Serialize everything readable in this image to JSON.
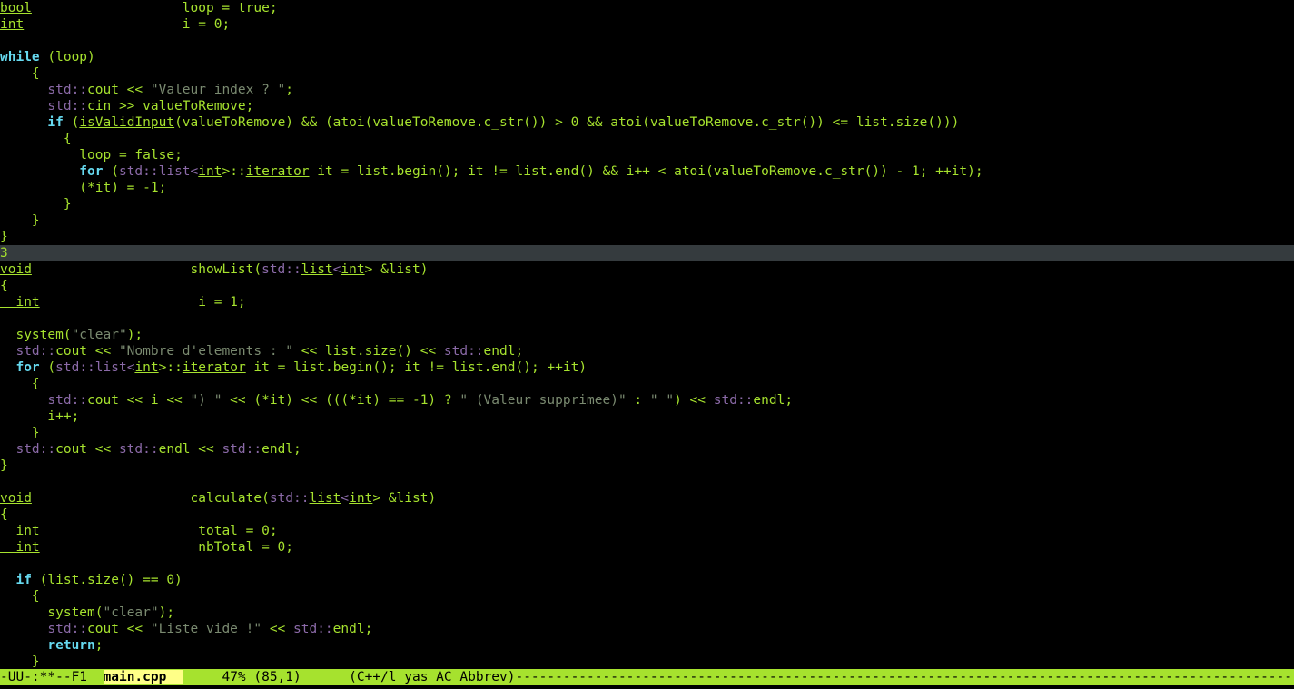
{
  "editor": {
    "lines": [
      [
        {
          "c": "type",
          "t": "bool"
        },
        {
          "c": "plain",
          "t": "                   loop = "
        },
        {
          "c": "const",
          "t": "true"
        },
        {
          "c": "plain",
          "t": ";"
        }
      ],
      [
        {
          "c": "type",
          "t": "int"
        },
        {
          "c": "plain",
          "t": "                    i = 0;"
        }
      ],
      [],
      [
        {
          "c": "keyword",
          "t": "while"
        },
        {
          "c": "plain",
          "t": " (loop)"
        }
      ],
      [
        {
          "c": "plain",
          "t": "    {"
        }
      ],
      [
        {
          "c": "ns",
          "t": "      std::"
        },
        {
          "c": "plain",
          "t": "cout << "
        },
        {
          "c": "string",
          "t": "\"Valeur index ? \""
        },
        {
          "c": "plain",
          "t": ";"
        }
      ],
      [
        {
          "c": "ns",
          "t": "      std::"
        },
        {
          "c": "plain",
          "t": "cin >> valueToRemove;"
        }
      ],
      [
        {
          "c": "keyword",
          "t": "      if"
        },
        {
          "c": "plain",
          "t": " ("
        },
        {
          "c": "func",
          "t": "isValidInput"
        },
        {
          "c": "plain",
          "t": "(valueToRemove) && (atoi(valueToRemove.c_str()) > 0 && atoi(valueToRemove.c_str()) <= list.size()))"
        }
      ],
      [
        {
          "c": "plain",
          "t": "        {"
        }
      ],
      [
        {
          "c": "plain",
          "t": "          loop = "
        },
        {
          "c": "const",
          "t": "false"
        },
        {
          "c": "plain",
          "t": ";"
        }
      ],
      [
        {
          "c": "keyword",
          "t": "          for"
        },
        {
          "c": "plain",
          "t": " ("
        },
        {
          "c": "ns",
          "t": "std::list<"
        },
        {
          "c": "type",
          "t": "int"
        },
        {
          "c": "plain",
          "t": ">::"
        },
        {
          "c": "type",
          "t": "iterator"
        },
        {
          "c": "plain",
          "t": " it = list.begin(); it != list.end() && i++ < atoi(valueToRemove.c_str()) - 1; ++it);"
        }
      ],
      [
        {
          "c": "plain",
          "t": "          (*it) = -1;"
        }
      ],
      [
        {
          "c": "plain",
          "t": "        }"
        }
      ],
      [
        {
          "c": "plain",
          "t": "    }"
        }
      ],
      [
        {
          "c": "plain",
          "t": "}"
        }
      ],
      [
        {
          "c": "plain",
          "t": "3"
        }
      ],
      [
        {
          "c": "type2",
          "t": "void"
        },
        {
          "c": "plain",
          "t": "                    showList("
        },
        {
          "c": "ns",
          "t": "std::"
        },
        {
          "c": "type",
          "t": "list"
        },
        {
          "c": "ns",
          "t": "<"
        },
        {
          "c": "type",
          "t": "int"
        },
        {
          "c": "plain",
          "t": "> &list)"
        }
      ],
      [
        {
          "c": "plain",
          "t": "{"
        }
      ],
      [
        {
          "c": "type",
          "t": "  int"
        },
        {
          "c": "plain",
          "t": "                    i = 1;"
        }
      ],
      [],
      [
        {
          "c": "plain",
          "t": "  system("
        },
        {
          "c": "string",
          "t": "\"clear\""
        },
        {
          "c": "plain",
          "t": ");"
        }
      ],
      [
        {
          "c": "ns",
          "t": "  std::"
        },
        {
          "c": "plain",
          "t": "cout << "
        },
        {
          "c": "string",
          "t": "\"Nombre d'elements : \""
        },
        {
          "c": "plain",
          "t": " << list.size() << "
        },
        {
          "c": "ns",
          "t": "std::"
        },
        {
          "c": "plain",
          "t": "endl;"
        }
      ],
      [
        {
          "c": "keyword",
          "t": "  for"
        },
        {
          "c": "plain",
          "t": " ("
        },
        {
          "c": "ns",
          "t": "std::list<"
        },
        {
          "c": "type",
          "t": "int"
        },
        {
          "c": "plain",
          "t": ">::"
        },
        {
          "c": "type",
          "t": "iterator"
        },
        {
          "c": "plain",
          "t": " it = list.begin(); it != list.end(); ++it)"
        }
      ],
      [
        {
          "c": "plain",
          "t": "    {"
        }
      ],
      [
        {
          "c": "ns",
          "t": "      std::"
        },
        {
          "c": "plain",
          "t": "cout << i << "
        },
        {
          "c": "string",
          "t": "\") \""
        },
        {
          "c": "plain",
          "t": " << (*it) << (((*it) == -1) ? "
        },
        {
          "c": "string",
          "t": "\" (Valeur supprimee)\""
        },
        {
          "c": "plain",
          "t": " : "
        },
        {
          "c": "string",
          "t": "\" \""
        },
        {
          "c": "plain",
          "t": ") << "
        },
        {
          "c": "ns",
          "t": "std::"
        },
        {
          "c": "plain",
          "t": "endl;"
        }
      ],
      [
        {
          "c": "plain",
          "t": "      i++;"
        }
      ],
      [
        {
          "c": "plain",
          "t": "    }"
        }
      ],
      [
        {
          "c": "ns",
          "t": "  std::"
        },
        {
          "c": "plain",
          "t": "cout << "
        },
        {
          "c": "ns",
          "t": "std::"
        },
        {
          "c": "plain",
          "t": "endl << "
        },
        {
          "c": "ns",
          "t": "std::"
        },
        {
          "c": "plain",
          "t": "endl;"
        }
      ],
      [
        {
          "c": "plain",
          "t": "}"
        }
      ],
      [],
      [
        {
          "c": "type2",
          "t": "void"
        },
        {
          "c": "plain",
          "t": "                    calculate("
        },
        {
          "c": "ns",
          "t": "std::"
        },
        {
          "c": "type",
          "t": "list"
        },
        {
          "c": "ns",
          "t": "<"
        },
        {
          "c": "type",
          "t": "int"
        },
        {
          "c": "plain",
          "t": "> &list)"
        }
      ],
      [
        {
          "c": "plain",
          "t": "{"
        }
      ],
      [
        {
          "c": "type",
          "t": "  int"
        },
        {
          "c": "plain",
          "t": "                    total = 0;"
        }
      ],
      [
        {
          "c": "type",
          "t": "  int"
        },
        {
          "c": "plain",
          "t": "                    nbTotal = 0;"
        }
      ],
      [],
      [
        {
          "c": "keyword",
          "t": "  if"
        },
        {
          "c": "plain",
          "t": " (list.size() == 0)"
        }
      ],
      [
        {
          "c": "plain",
          "t": "    {"
        }
      ],
      [
        {
          "c": "plain",
          "t": "      system("
        },
        {
          "c": "string",
          "t": "\"clear\""
        },
        {
          "c": "plain",
          "t": ");"
        }
      ],
      [
        {
          "c": "ns",
          "t": "      std::"
        },
        {
          "c": "plain",
          "t": "cout << "
        },
        {
          "c": "string",
          "t": "\"Liste vide !\""
        },
        {
          "c": "plain",
          "t": " << "
        },
        {
          "c": "ns",
          "t": "std::"
        },
        {
          "c": "plain",
          "t": "endl;"
        }
      ],
      [
        {
          "c": "keyword",
          "t": "      return"
        },
        {
          "c": "plain",
          "t": ";"
        }
      ],
      [
        {
          "c": "plain",
          "t": "    }"
        }
      ]
    ],
    "current_line_index": 15
  },
  "modeline": {
    "status": "-UU-:**--F1  ",
    "buffer_name": "main.cpp  ",
    "position": "     47% (85,1)      ",
    "modes": "(C++/l yas AC Abbrev)",
    "fill": "------------------------------------------------------------------------------------------------------------------------------------------------------------------------"
  },
  "colors": {
    "background": "#000000",
    "foreground": "#a6e22e",
    "keyword": "#66d9ef",
    "string": "#7a8a70",
    "namespace": "#8b6aa8",
    "modeline_bg": "#a6e22e",
    "buffer_name_bg": "#ffff87",
    "current_line_bg": "#353b3e"
  }
}
